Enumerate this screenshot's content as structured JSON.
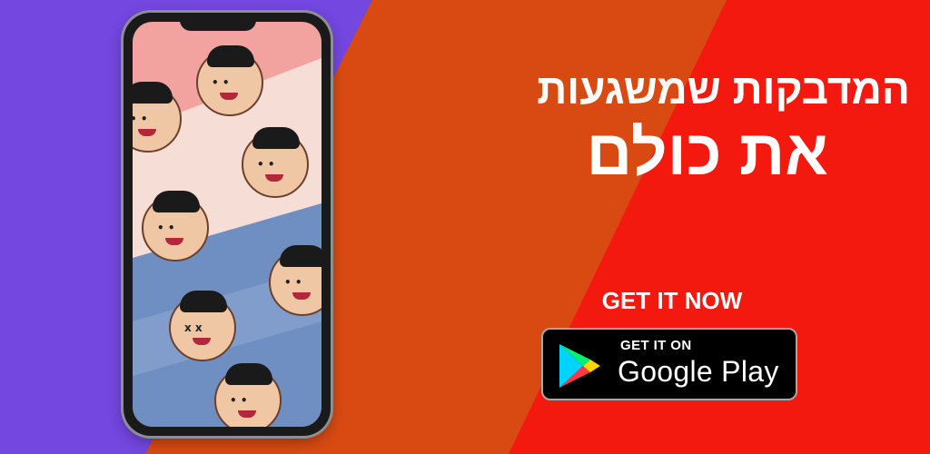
{
  "colors": {
    "left_panel": "#7347e0",
    "middle_panel": "#d94a12",
    "right_panel": "#f4190f",
    "badge_bg": "#000000",
    "text": "#ffffff"
  },
  "headline": {
    "line1": "המדבקות שמשגעות",
    "line2": "את כולם"
  },
  "cta": {
    "label": "GET IT NOW"
  },
  "store_badge": {
    "small_text": "GET IT ON",
    "big_text": "Google Play",
    "icon": "google-play-icon"
  },
  "phone": {
    "icon": "phone-mockup",
    "stickers": [
      "sticker-face",
      "sticker-face",
      "sticker-face",
      "sticker-face",
      "sticker-face",
      "sticker-face",
      "sticker-face"
    ]
  }
}
